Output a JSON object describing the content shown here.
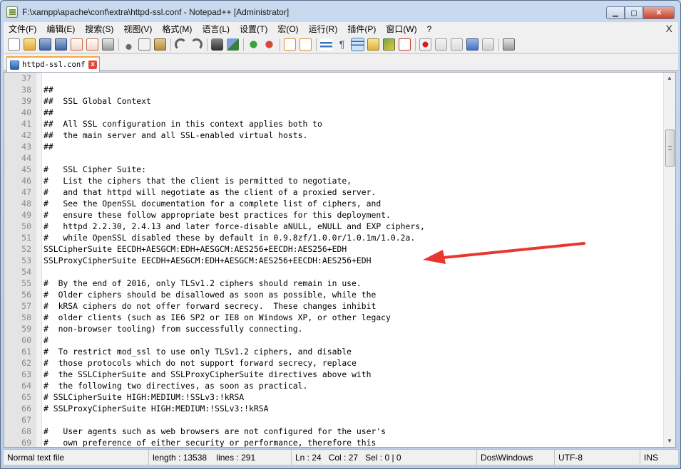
{
  "window": {
    "title": "F:\\xampp\\apache\\conf\\extra\\httpd-ssl.conf - Notepad++ [Administrator]",
    "minimize_glyph": "▁",
    "maximize_glyph": "▢",
    "close_glyph": "✕"
  },
  "menu": {
    "items": [
      "文件(F)",
      "编辑(E)",
      "搜索(S)",
      "视图(V)",
      "格式(M)",
      "语言(L)",
      "设置(T)",
      "宏(O)",
      "运行(R)",
      "插件(P)",
      "窗口(W)",
      "?"
    ],
    "close_glyph": "X"
  },
  "toolbar": {
    "icons": [
      "new-file-icon",
      "open-file-icon",
      "save-icon",
      "save-all-icon",
      "close-icon",
      "close-all-icon",
      "print-icon",
      "cut-icon",
      "copy-icon",
      "paste-icon",
      "undo-icon",
      "redo-icon",
      "find-icon",
      "replace-icon",
      "zoom-in-icon",
      "zoom-out-icon",
      "sync-vertical-icon",
      "sync-horizontal-icon",
      "word-wrap-icon",
      "show-all-chars-icon",
      "indent-guide-icon",
      "user-lang-icon",
      "doc-map-icon",
      "function-list-icon",
      "record-macro-icon",
      "stop-record-icon",
      "play-macro-icon",
      "run-macro-multiple-icon",
      "save-macro-icon",
      "spell-check-icon"
    ]
  },
  "tab": {
    "label": "httpd-ssl.conf",
    "close_glyph": "x"
  },
  "editor": {
    "lines": [
      {
        "n": "37",
        "t": ""
      },
      {
        "n": "38",
        "t": "##"
      },
      {
        "n": "39",
        "t": "##  SSL Global Context"
      },
      {
        "n": "40",
        "t": "##"
      },
      {
        "n": "41",
        "t": "##  All SSL configuration in this context applies both to"
      },
      {
        "n": "42",
        "t": "##  the main server and all SSL-enabled virtual hosts."
      },
      {
        "n": "43",
        "t": "##"
      },
      {
        "n": "44",
        "t": ""
      },
      {
        "n": "45",
        "t": "#   SSL Cipher Suite:"
      },
      {
        "n": "46",
        "t": "#   List the ciphers that the client is permitted to negotiate,"
      },
      {
        "n": "47",
        "t": "#   and that httpd will negotiate as the client of a proxied server."
      },
      {
        "n": "48",
        "t": "#   See the OpenSSL documentation for a complete list of ciphers, and"
      },
      {
        "n": "49",
        "t": "#   ensure these follow appropriate best practices for this deployment."
      },
      {
        "n": "50",
        "t": "#   httpd 2.2.30, 2.4.13 and later force-disable aNULL, eNULL and EXP ciphers,"
      },
      {
        "n": "51",
        "t": "#   while OpenSSL disabled these by default in 0.9.8zf/1.0.0r/1.0.1m/1.0.2a."
      },
      {
        "n": "52",
        "t": "SSLCipherSuite EECDH+AESGCM:EDH+AESGCM:AES256+EECDH:AES256+EDH"
      },
      {
        "n": "53",
        "t": "SSLProxyCipherSuite EECDH+AESGCM:EDH+AESGCM:AES256+EECDH:AES256+EDH"
      },
      {
        "n": "54",
        "t": ""
      },
      {
        "n": "55",
        "t": "#  By the end of 2016, only TLSv1.2 ciphers should remain in use."
      },
      {
        "n": "56",
        "t": "#  Older ciphers should be disallowed as soon as possible, while the"
      },
      {
        "n": "57",
        "t": "#  kRSA ciphers do not offer forward secrecy.  These changes inhibit"
      },
      {
        "n": "58",
        "t": "#  older clients (such as IE6 SP2 or IE8 on Windows XP, or other legacy"
      },
      {
        "n": "59",
        "t": "#  non-browser tooling) from successfully connecting."
      },
      {
        "n": "60",
        "t": "#"
      },
      {
        "n": "61",
        "t": "#  To restrict mod_ssl to use only TLSv1.2 ciphers, and disable"
      },
      {
        "n": "62",
        "t": "#  those protocols which do not support forward secrecy, replace"
      },
      {
        "n": "63",
        "t": "#  the SSLCipherSuite and SSLProxyCipherSuite directives above with"
      },
      {
        "n": "64",
        "t": "#  the following two directives, as soon as practical."
      },
      {
        "n": "65",
        "t": "# SSLCipherSuite HIGH:MEDIUM:!SSLv3:!kRSA"
      },
      {
        "n": "66",
        "t": "# SSLProxyCipherSuite HIGH:MEDIUM:!SSLv3:!kRSA"
      },
      {
        "n": "67",
        "t": ""
      },
      {
        "n": "68",
        "t": "#   User agents such as web browsers are not configured for the user's"
      },
      {
        "n": "69",
        "t": "#   own preference of either security or performance, therefore this"
      }
    ],
    "annotation_color": "#e8372e"
  },
  "statusbar": {
    "file_type": "Normal text file",
    "length": "length : 13538",
    "lines": "lines : 291",
    "ln": "Ln : 24",
    "col": "Col : 27",
    "sel": "Sel : 0 | 0",
    "eol": "Dos\\Windows",
    "encoding": "UTF-8",
    "mode": "INS"
  }
}
